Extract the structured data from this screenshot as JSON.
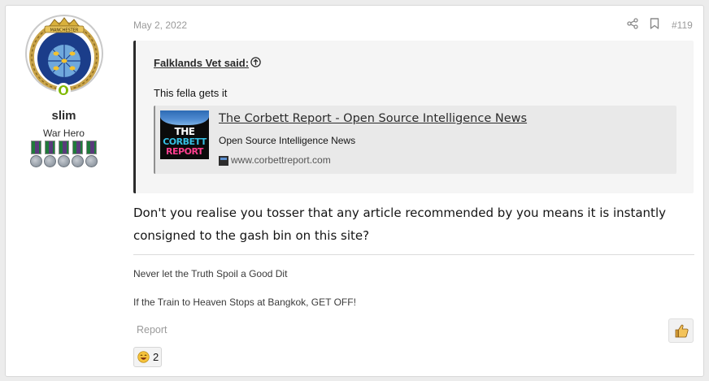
{
  "user": {
    "name": "slim",
    "title": "War Hero",
    "avatar_banner": "MANCHESTER",
    "status": "online",
    "medal_count": 5
  },
  "post": {
    "date": "May 2, 2022",
    "number": "#119",
    "quote": {
      "author": "Falklands Vet said:",
      "text": "This fella gets it",
      "unfurl": {
        "title": "The Corbett Report - Open Source Intelligence News",
        "description": "Open Source Intelligence News",
        "domain": "www.corbettreport.com",
        "thumbnail_lines": [
          "THE",
          "CORBETT",
          "REPORT"
        ]
      }
    },
    "message": "Don't you realise you tosser that any article recommended by you means it is instantly consigned to the gash bin on this site?",
    "signature": [
      "Never let the Truth Spoil a Good Dit",
      "If the Train to Heaven Stops at Bangkok, GET OFF!"
    ]
  },
  "actions": {
    "report_label": "Report",
    "reaction_count": "2"
  },
  "icons": {
    "share": "share-icon",
    "bookmark": "bookmark-icon",
    "quote_expand": "arrow-up-circle-icon",
    "like": "thumbs-up-icon",
    "reaction": "laughing-face-icon"
  },
  "colors": {
    "online": "#7fb900",
    "quote_bar": "#2b2b2b",
    "muted_text": "#9a9a9a"
  }
}
